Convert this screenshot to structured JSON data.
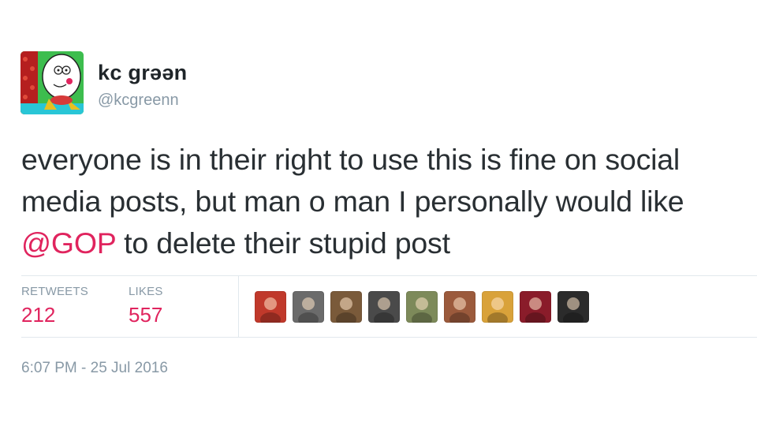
{
  "author": {
    "display_name": "kc grəən",
    "handle": "@kcgreenn"
  },
  "tweet": {
    "text_before": "everyone is in their right to use this is fine on social media posts, but man o man I personally would like ",
    "mention": "@GOP",
    "text_after": " to delete their stupid post"
  },
  "stats": {
    "retweets_label": "RETWEETS",
    "retweets_value": "212",
    "likes_label": "LIKES",
    "likes_value": "557"
  },
  "liker_avatars": [
    {
      "name": "avatar-1",
      "color": "#c0392b"
    },
    {
      "name": "avatar-2",
      "color": "#6b6b6b"
    },
    {
      "name": "avatar-3",
      "color": "#7a5a3a"
    },
    {
      "name": "avatar-4",
      "color": "#4a4a4a"
    },
    {
      "name": "avatar-5",
      "color": "#7d8a5a"
    },
    {
      "name": "avatar-6",
      "color": "#9b5a3c"
    },
    {
      "name": "avatar-7",
      "color": "#d9a23a"
    },
    {
      "name": "avatar-8",
      "color": "#8a1c2a"
    },
    {
      "name": "avatar-9",
      "color": "#2b2b2b"
    }
  ],
  "timestamp": "6:07 PM - 25 Jul 2016",
  "colors": {
    "accent": "#e0245e",
    "muted": "#8899a6",
    "text": "#292f33"
  }
}
